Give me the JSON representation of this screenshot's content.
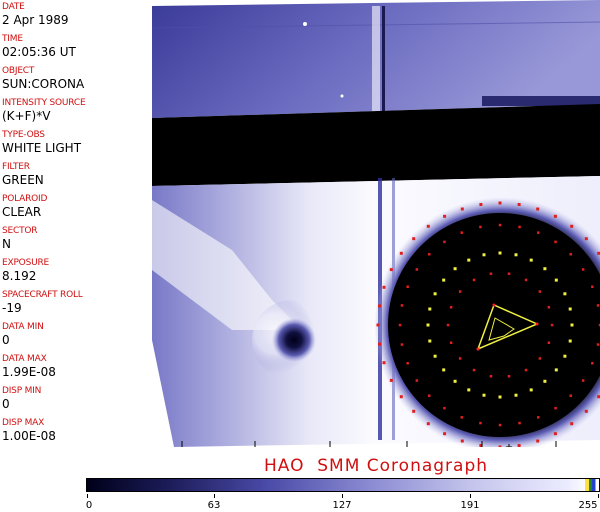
{
  "sidebar": {
    "fields": [
      {
        "label": "DATE",
        "value": "2 Apr 1989"
      },
      {
        "label": "TIME",
        "value": "02:05:36 UT"
      },
      {
        "label": "OBJECT",
        "value": "SUN:CORONA"
      },
      {
        "label": "INTENSITY SOURCE",
        "value": "(K+F)*V"
      },
      {
        "label": "TYPE-OBS",
        "value": "WHITE LIGHT"
      },
      {
        "label": "FILTER",
        "value": "GREEN"
      },
      {
        "label": "POLAROID",
        "value": "CLEAR"
      },
      {
        "label": "SECTOR",
        "value": "N"
      },
      {
        "label": "EXPOSURE",
        "value": "8.192"
      },
      {
        "label": "SPACECRAFT ROLL",
        "value": "-19"
      },
      {
        "label": "DATA MIN",
        "value": "0"
      },
      {
        "label": "DATA MAX",
        "value": "1.99E-08"
      },
      {
        "label": "DISP MIN",
        "value": "0"
      },
      {
        "label": "DISP MAX",
        "value": "1.00E-08"
      }
    ]
  },
  "caption": "HAO  SMM Coronagraph",
  "colorbar": {
    "ticks": [
      "0",
      "63",
      "127",
      "191",
      "255"
    ]
  },
  "colors": {
    "label_red": "#d01010",
    "image_blue": "#4a4aa8",
    "occulter_dots_red": "#e02020",
    "occulter_dots_yellow": "#f0f040"
  }
}
